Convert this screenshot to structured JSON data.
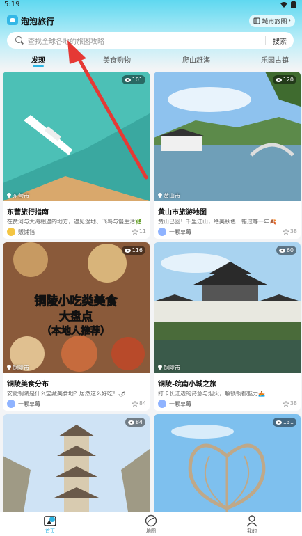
{
  "status_bar": {
    "time": "5:19"
  },
  "header": {
    "app_title": "泡泡旅行",
    "city_guide": "城市旅图",
    "chevron": "›"
  },
  "search": {
    "placeholder": "查找全球各地的旅图攻略",
    "button": "搜索"
  },
  "tabs": [
    {
      "label": "发现",
      "active": true
    },
    {
      "label": "美食购物"
    },
    {
      "label": "爬山赶海"
    },
    {
      "label": "乐园古镇"
    }
  ],
  "cards": [
    {
      "views": "101",
      "location": "东营市",
      "title": "东营旅行指南",
      "desc": "在黄河与大海相遇的地方，遇见湿地、飞鸟与慢生活🌿",
      "author": "贩铺铛",
      "likes": "11",
      "avatar_color": "#f4c542",
      "image_colors": [
        "#3aa8a0",
        "#d9a86c"
      ]
    },
    {
      "views": "120",
      "location": "黄山市",
      "title": "黄山市旅游地图",
      "desc": "黄山已回！千里江山，绝美秋色…错过等一年🍂",
      "author": "一颗草莓",
      "likes": "38",
      "avatar_color": "#8fb3ff",
      "image_colors": [
        "#7fb6e6",
        "#5c8a4a"
      ]
    },
    {
      "views": "116",
      "location": "铜陵市",
      "title": "铜陵美食分布",
      "desc": "安徽铜陵居然这么好吃！🌶",
      "desc_full": "安徽铜陵是什么宝藏美食地？居然这么好吃！🌶",
      "author": "一颗草莓",
      "likes": "84",
      "avatar_color": "#8fb3ff",
      "overlay_lines": [
        "铜陵小吃类美食",
        "大盘点",
        "（本地人推荐）"
      ],
      "image_colors": [
        "#8a5a3a",
        "#e0b070"
      ]
    },
    {
      "views": "60",
      "location": "铜陵市",
      "title": "铜陵-皖南小城之旅",
      "desc": "打卡长江边的诗意与烟火，解锁铜都魅力🚣",
      "author": "一颗草莓",
      "likes": "38",
      "avatar_color": "#8fb3ff",
      "image_colors": [
        "#a9d3f0",
        "#4a6b3a"
      ]
    },
    {
      "views": "84",
      "image_colors": [
        "#cfe3f5",
        "#9a8a70"
      ]
    },
    {
      "views": "131",
      "image_colors": [
        "#7ec0ee",
        "#bfa888"
      ]
    }
  ],
  "bottom_nav": [
    {
      "label": "首页",
      "icon": "home-icon",
      "active": true
    },
    {
      "label": "地图",
      "icon": "map-icon"
    },
    {
      "label": "我的",
      "icon": "profile-icon"
    }
  ],
  "colors": {
    "accent": "#2db4e3",
    "annotation": "#e53935"
  }
}
